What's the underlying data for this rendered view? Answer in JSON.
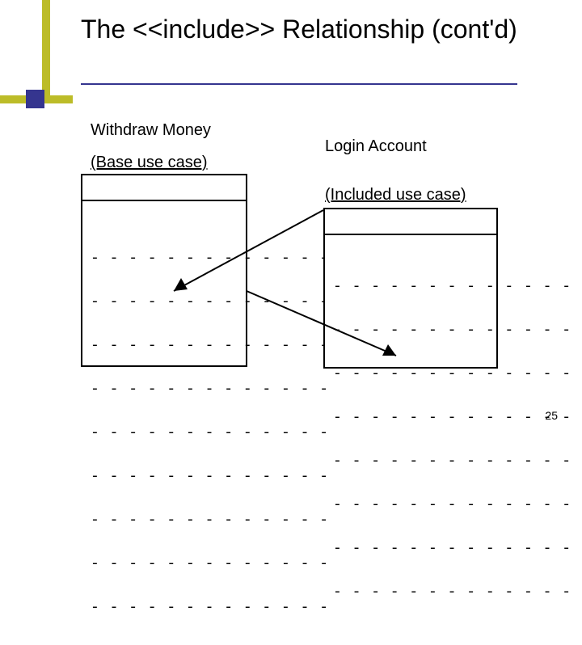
{
  "title": "The <<include>> Relationship (cont'd)",
  "left": {
    "name": "Withdraw Money",
    "role": "(Base use case)"
  },
  "right": {
    "name": "Login Account",
    "role": "(Included use case)"
  },
  "dash_row": "- - - - - - - - - - - - -",
  "page_number": "25"
}
